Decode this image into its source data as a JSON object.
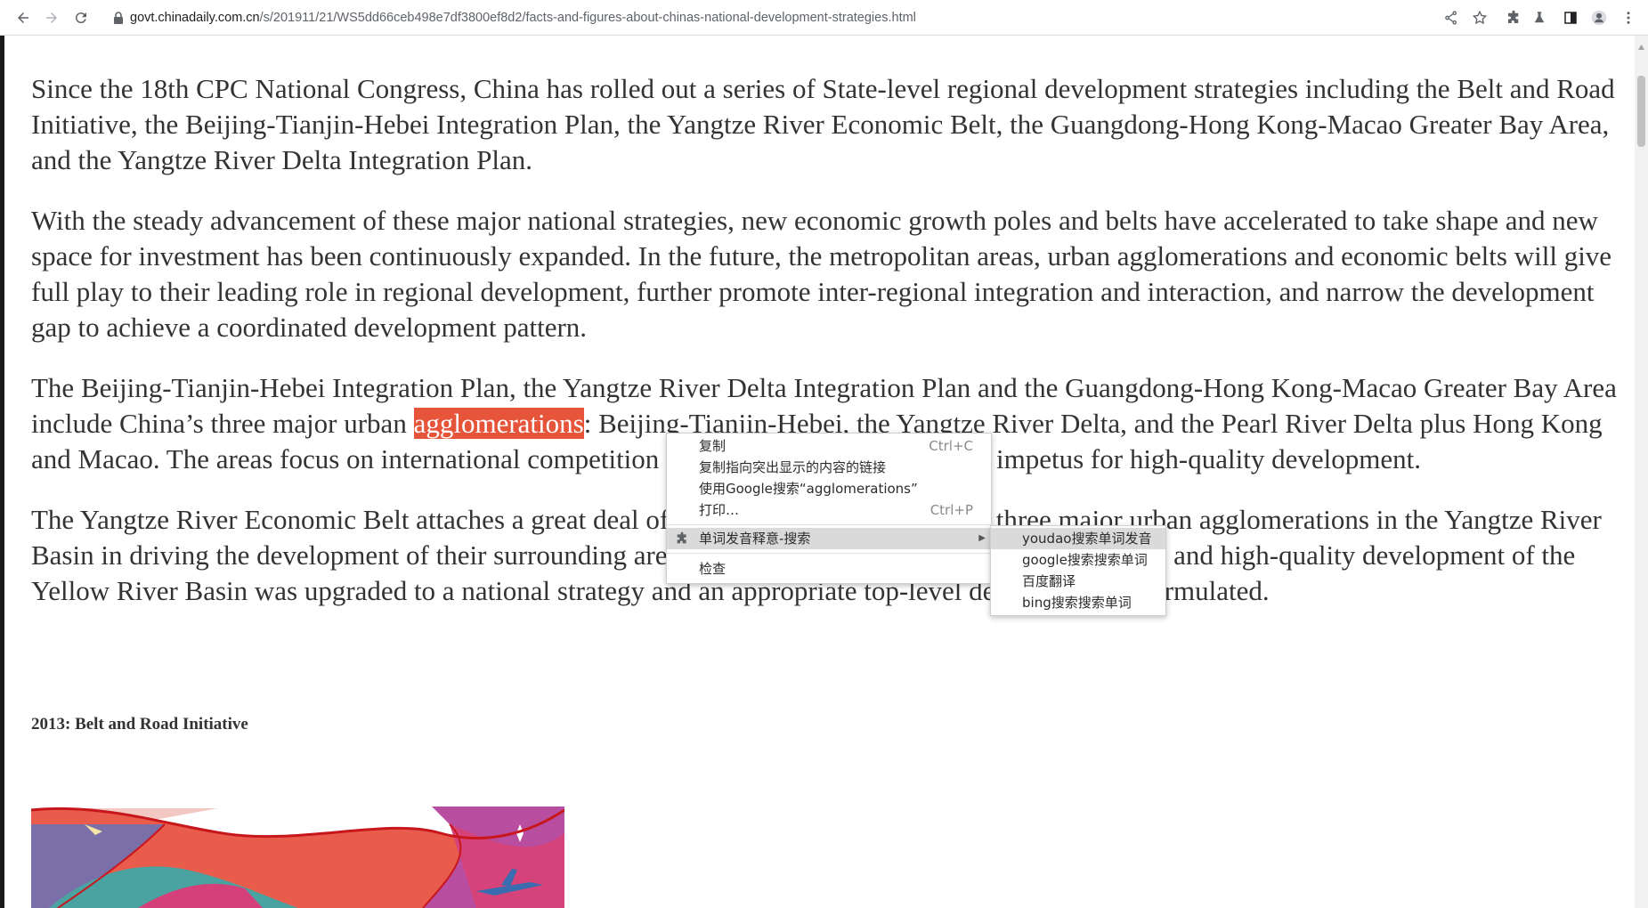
{
  "browser": {
    "url_host": "govt.chinadaily.com.cn",
    "url_path": "/s/201911/21/WS5dd66ceb498e7df3800ef8d2/facts-and-figures-about-chinas-national-development-strategies.html"
  },
  "article": {
    "p1": "Since the 18th CPC National Congress, China has rolled out a series of State-level regional development strategies including the Belt and Road Initiative, the Beijing-Tianjin-Hebei Integration Plan, the Yangtze River Economic Belt, the Guangdong-Hong Kong-Macao Greater Bay Area, and the Yangtze River Delta Integration Plan.",
    "p2": "With the steady advancement of these major national strategies, new economic growth poles and belts have accelerated to take shape and new space for investment has been continuously expanded. In the future, the metropolitan areas, urban agglomerations and economic belts will give full play to their leading role in regional development, further promote inter-regional integration and interaction, and narrow the development gap to achieve a coordinated development pattern.",
    "p3_before": "The Beijing-Tianjin-Hebei Integration Plan, the Yangtze River Delta Integration Plan and the Guangdong-Hong Kong-Macao Greater Bay Area include China’s three major urban ",
    "p3_selected": "agglomerations",
    "p3_after": ": Beijing-Tianjin-Hebei, the Yangtze River Delta, and the Pearl River Delta plus Hong Kong and Macao. The areas focus on international competition and are creating an important impetus for high-quality development.",
    "p4": "The Yangtze River Economic Belt attaches a great deal of importance to the role of the three major urban agglomerations in the Yangtze River Basin in driving the development of their surrounding areas. In September, the ecological conservation and high-quality development of the Yellow River Basin was upgraded to a national strategy and an appropriate top-level design is being formulated.",
    "heading": "2013: Belt and Road Initiative"
  },
  "context_menu": {
    "copy": "复制",
    "copy_shortcut": "Ctrl+C",
    "copy_link": "复制指向突出显示的内容的链接",
    "google_search": "使用Google搜索“agglomerations”",
    "print": "打印…",
    "print_shortcut": "Ctrl+P",
    "extension": "单词发音释意-搜索",
    "inspect": "检查"
  },
  "submenu": {
    "items": [
      "youdao搜索单词发音",
      "google搜索搜索单词",
      "百度翻译",
      "bing搜索搜索单词"
    ]
  },
  "colors": {
    "selection": "#e6543a",
    "text": "#333333",
    "menu_highlight": "#dadada"
  }
}
